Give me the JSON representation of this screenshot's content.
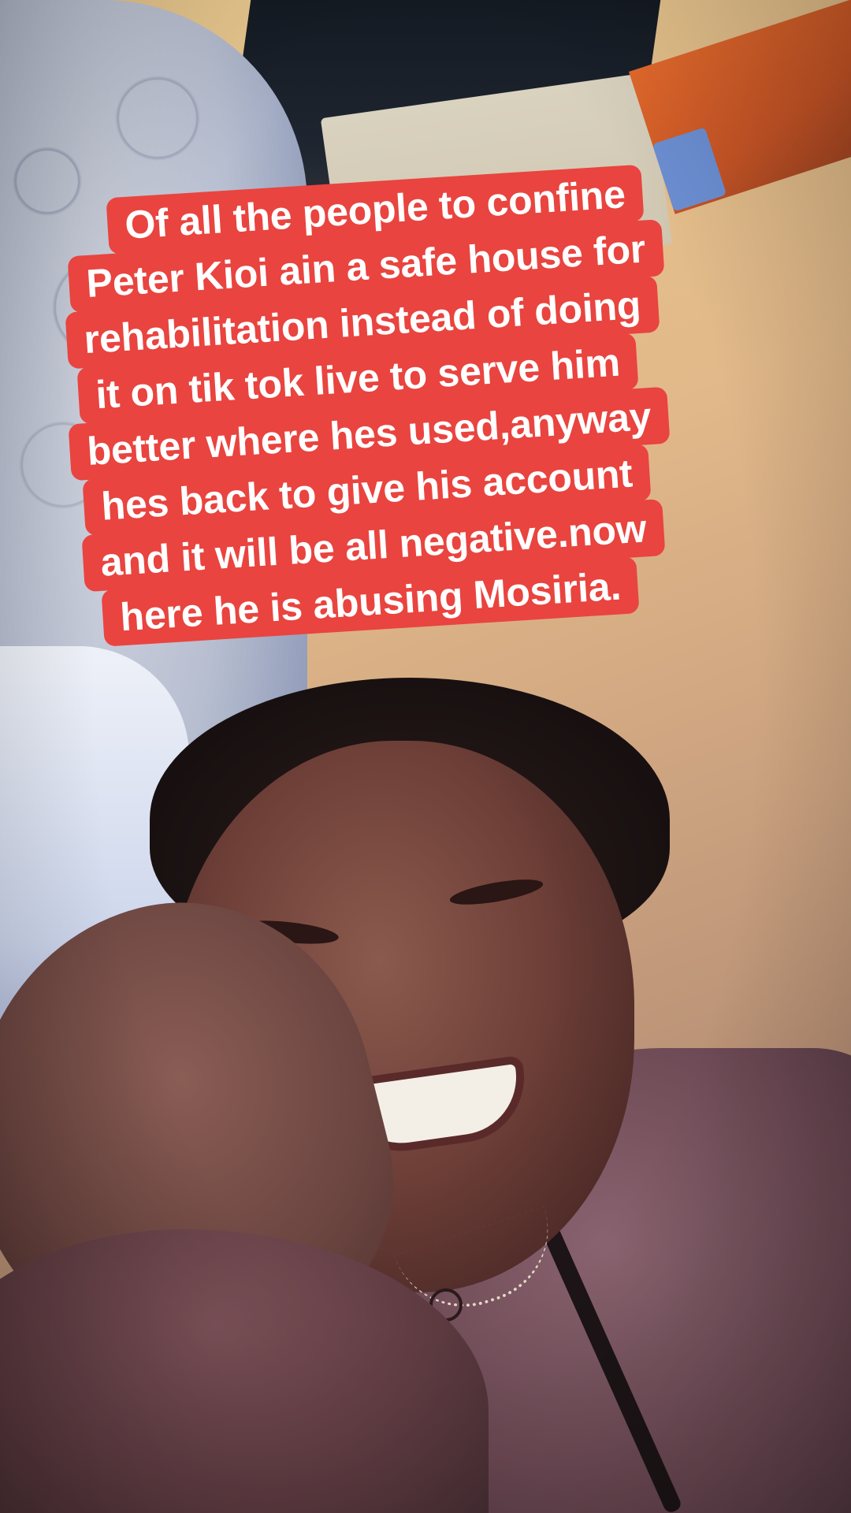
{
  "video": {
    "scene_description_name": "selfie-video-frame"
  },
  "caption": {
    "lines": [
      "Of all the people to confine",
      "Peter Kioi ain a safe house for",
      "rehabilitation instead of doing",
      "it on tik tok live to serve him",
      "better where hes used,anyway",
      "hes back to give his account",
      "and it will be all negative.now",
      "here he is abusing  Mosiria."
    ],
    "background_color": "#e9443f",
    "text_color": "#ffffff"
  }
}
